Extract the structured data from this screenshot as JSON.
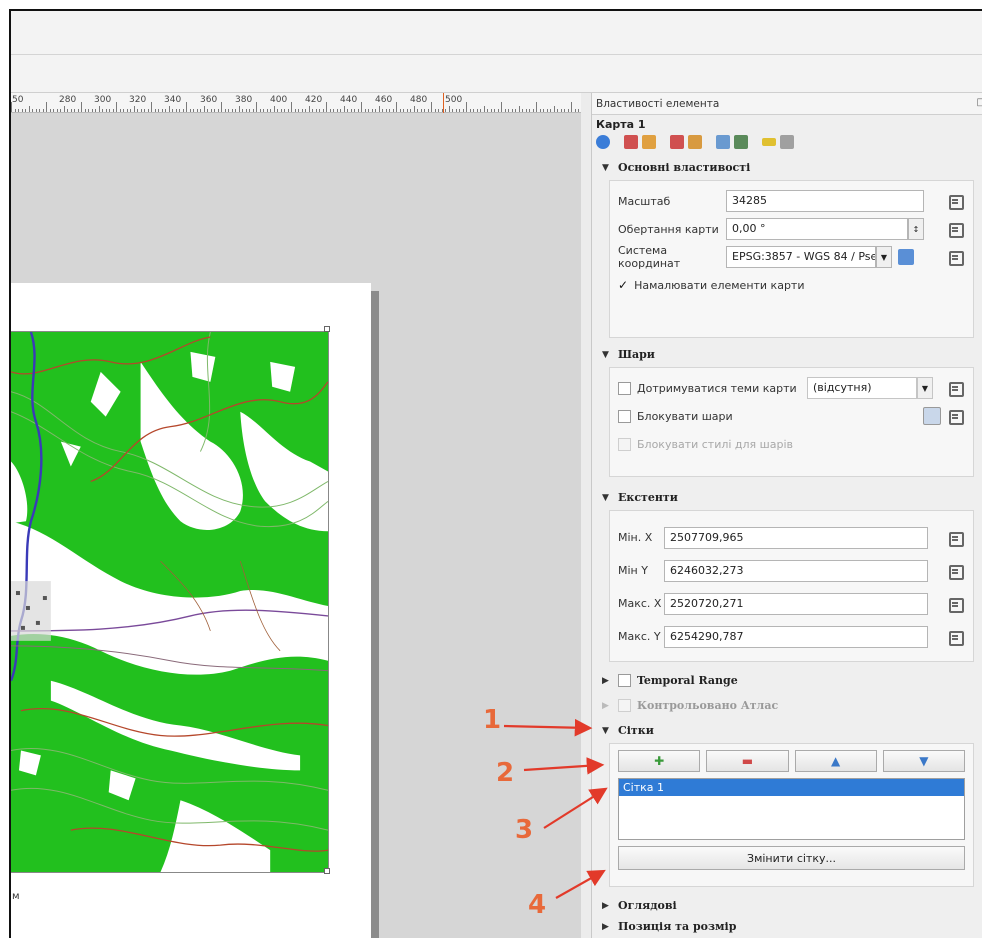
{
  "ruler": {
    "labels": [
      "50",
      "280",
      "300",
      "320",
      "340",
      "360",
      "380",
      "400",
      "420",
      "440",
      "460",
      "480",
      "500"
    ]
  },
  "map": {
    "caption": "м"
  },
  "panel": {
    "header": "Властивості елемента",
    "item_title": "Карта 1",
    "main_props": {
      "title": "Основні властивості",
      "scale_label": "Масштаб",
      "scale_value": "34285",
      "rotation_label": "Обертання карти",
      "rotation_value": "0,00 °",
      "crs_label": "Система координат",
      "crs_value": "EPSG:3857 - WGS 84 / Pse",
      "draw_items_label": "Намалювати елементи карти"
    },
    "layers": {
      "title": "Шари",
      "follow_theme_label": "Дотримуватися теми карти",
      "theme_value": "(відсутня)",
      "lock_layers_label": "Блокувати шари",
      "lock_styles_label": "Блокувати стилі для шарів"
    },
    "extents": {
      "title": "Екстенти",
      "xmin_label": "Мін. X",
      "xmin_value": "2507709,965",
      "ymin_label": "Мін Y",
      "ymin_value": "6246032,273",
      "xmax_label": "Макс. X",
      "xmax_value": "2520720,271",
      "ymax_label": "Макс. Y",
      "ymax_value": "6254290,787"
    },
    "temporal": {
      "title": "Temporal Range"
    },
    "atlas": {
      "title": "Контрольовано Атлас"
    },
    "grids": {
      "title": "Сітки",
      "items": [
        "Сітка 1"
      ],
      "modify_label": "Змінити сітку..."
    },
    "overviews": {
      "title": "Оглядові"
    },
    "position": {
      "title": "Позиція та розмір"
    }
  },
  "annotations": {
    "n1": "1",
    "n2": "2",
    "n3": "3",
    "n4": "4"
  },
  "colors": {
    "annotation": "#e8693a",
    "map_green": "#22c01e",
    "selection": "#2f7bd6"
  }
}
